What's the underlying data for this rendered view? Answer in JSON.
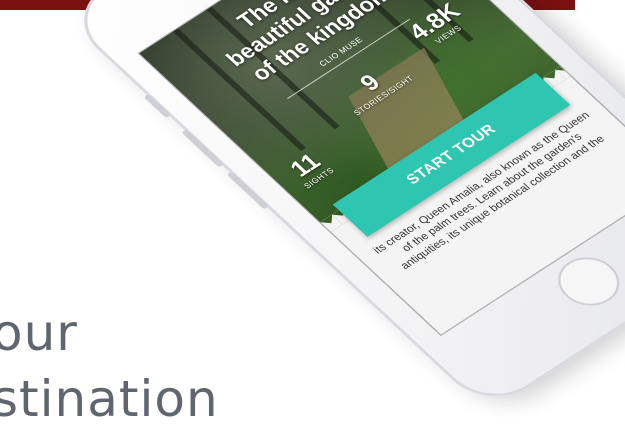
{
  "hero": {
    "line1": "our",
    "line2": "stination"
  },
  "app": {
    "title_line1": "The most",
    "title_line2": "beautiful garden",
    "title_line3": "of the kingdom",
    "subtitle": "CLIO MUSE",
    "stats": [
      {
        "value": "11",
        "label": "SIGHTS"
      },
      {
        "value": "9",
        "label": "STORIES/SIGHT"
      },
      {
        "value": "4.8K",
        "label": "VIEWS"
      }
    ],
    "start_button": "START TOUR",
    "description": "its creator, Queen Amalia, also known as the Queen of the palm trees. Learn about the garden's antiquities, its unique botanical collection and the"
  },
  "colors": {
    "brand_bar": "#7b1111",
    "button": "#2ec6b0"
  }
}
